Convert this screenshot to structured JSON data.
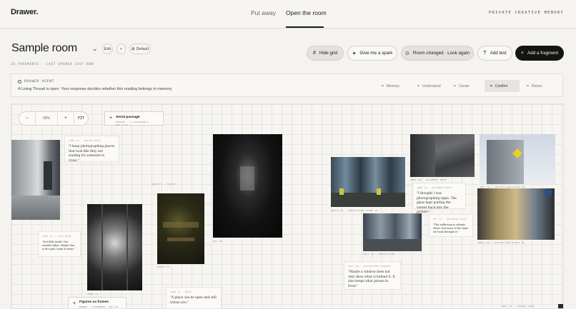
{
  "header": {
    "logo": "Drawer.",
    "tabs": [
      {
        "label": "Put away"
      },
      {
        "label": "Open the room"
      }
    ],
    "tagline": "PRIVATE CREATIVE MEMORY"
  },
  "room": {
    "title": "Sample room",
    "edit_label": "Edit",
    "add_label": "+",
    "default_label": "Default",
    "meta": "20 FRAGMENTS · LAST OPENED JUST NOW"
  },
  "toolbar": {
    "hide_grid": "Hide grid",
    "spark": "Give me a spark",
    "room_changed": "Room changed · Look again",
    "add_text": "Add text",
    "add_fragment": "Add a fragment"
  },
  "agent": {
    "label": "DRAWER AGENT",
    "message": "A Living Thread is open. Your response decides whether this reading belongs in memory.",
    "steps": [
      {
        "label": "Memory",
        "active": false
      },
      {
        "label": "Understand",
        "active": false
      },
      {
        "label": "Curate",
        "active": false
      },
      {
        "label": "Confirm",
        "active": true
      },
      {
        "label": "Return",
        "active": false
      }
    ]
  },
  "canvas": {
    "zoom": {
      "minus": "−",
      "value": "59%",
      "plus": "+",
      "fit": "FIT"
    },
    "serial": {
      "title": "Serial passage",
      "sub": "DRAWER · 3 FRAGMENTS · OPT.A·B"
    },
    "figures": {
      "title": "Figures as frames",
      "sub": "DRAWER · 3 FRAGMENTS · OPT.A·B"
    },
    "notes": [
      {
        "head": "JUNE 14 · INSIDE NOTE",
        "quote": "\"I keep photographing places that look like they are waiting for someone to cross.\""
      },
      {
        "head": "JUNE 16 · SIDE NOTE",
        "quote": "\"Not fully inside. Not outside either. Maybe that is the part I want to keep.\""
      },
      {
        "head": "JUNE 11 · NOTE",
        "quote": "\"A place can be open and still refuse you.\""
      },
      {
        "head": "JUNE 20 · DOCUMENT NOTE",
        "quote": "\"I thought I was photographing signs. The glass kept putting the viewer back into the picture.\""
      },
      {
        "head": "MAY 12 · DOCUMENT NOTE",
        "quote": "\"The reflection is always there, but most of the time we look through it.\""
      },
      {
        "head": "JULY 08 · UNFINISHED THOUGHT",
        "quote": "\"Maybe a window does not only show what is behind it. It also keeps what passes in front.\""
      }
    ],
    "captions": {
      "p_left": "",
      "p_stairs": "JUNE 16",
      "p_cafe_head": "MARCH 5 · PLACE",
      "p_cafe": "MARCH 05",
      "p_hall": "MAY 06",
      "p_windows": "MARCH 05 · REFLECTION STUDY 02",
      "p_building": "JUNE 20 · DOCUMENT NOTE",
      "p_tower": "JULY 04 · REFLECTION STUDY 01",
      "p_glass": "APRIL 02 · REFLECTION STUDY 03",
      "p_reflect": "JULY 02 · REFLECTION",
      "p_bottom": "JUNE 13 · COMING SOON"
    }
  }
}
